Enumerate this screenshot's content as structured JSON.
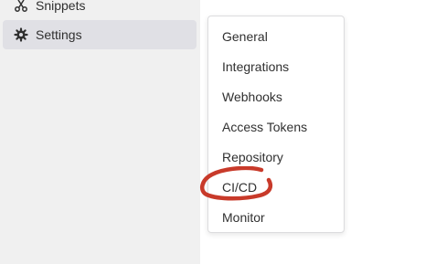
{
  "sidebar": {
    "items": [
      {
        "label": "Snippets",
        "icon": "snippets-icon"
      },
      {
        "label": "Settings",
        "icon": "settings-gear-icon",
        "active": true
      }
    ]
  },
  "dropdown": {
    "items": [
      {
        "label": "General"
      },
      {
        "label": "Integrations"
      },
      {
        "label": "Webhooks"
      },
      {
        "label": "Access Tokens"
      },
      {
        "label": "Repository"
      },
      {
        "label": "CI/CD",
        "highlighted": true
      },
      {
        "label": "Monitor"
      }
    ]
  },
  "colors": {
    "sidebar_bg": "#f0f0f0",
    "active_bg": "#e0e0e5",
    "annotation_red": "#c83a2a",
    "text": "#303030"
  }
}
